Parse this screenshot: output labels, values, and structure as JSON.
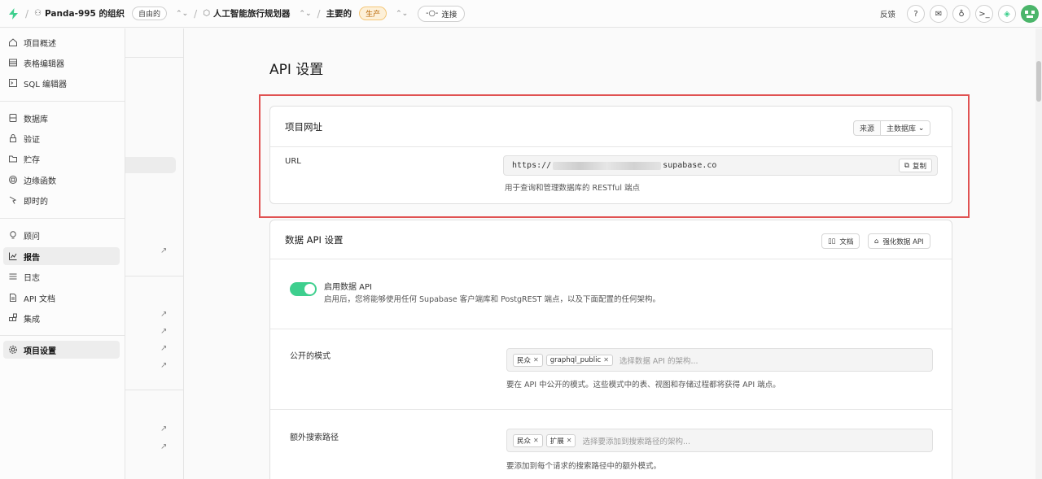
{
  "topbar": {
    "org_name": "Panda-995 的组织",
    "org_plan": "自由的",
    "project_name": "人工智能旅行规划器",
    "branch_name": "主要的",
    "branch_env": "生产",
    "connect_label": "连接",
    "feedback_label": "反馈",
    "brand_color": "#3ecf8e"
  },
  "nav": {
    "items": [
      {
        "label": "项目概述",
        "icon": "home-icon"
      },
      {
        "label": "表格编辑器",
        "icon": "table-icon"
      },
      {
        "label": "SQL 编辑器",
        "icon": "terminal-icon"
      },
      {
        "label": "数据库",
        "icon": "database-icon"
      },
      {
        "label": "验证",
        "icon": "lock-icon"
      },
      {
        "label": "贮存",
        "icon": "folder-icon"
      },
      {
        "label": "边缘函数",
        "icon": "function-icon"
      },
      {
        "label": "即时的",
        "icon": "cursor-icon"
      },
      {
        "label": "顾问",
        "icon": "lightbulb-icon"
      },
      {
        "label": "报告",
        "icon": "chart-icon"
      },
      {
        "label": "日志",
        "icon": "list-icon"
      },
      {
        "label": "API 文档",
        "icon": "document-icon"
      },
      {
        "label": "集成",
        "icon": "blocks-icon"
      },
      {
        "label": "项目设置",
        "icon": "gear-icon"
      }
    ]
  },
  "main": {
    "title": "API 设置",
    "project_url": {
      "title": "项目网址",
      "source_label": "来源",
      "source_value": "主数据库",
      "url_label": "URL",
      "url_prefix": "https://",
      "url_suffix": "supabase.co",
      "copy_label": "复制",
      "hint": "用于查询和管理数据库的 RESTful 端点"
    },
    "data_api": {
      "title": "数据 API 设置",
      "docs_label": "文档",
      "harden_label": "强化数据 API",
      "enable_label": "启用数据 API",
      "enable_desc": "启用后，您将能够使用任何 Supabase 客户端库和 PostgREST 端点，以及下面配置的任何架构。",
      "enabled": true,
      "exposed_label": "公开的模式",
      "exposed_tags": [
        "民众",
        "graphql_public"
      ],
      "exposed_placeholder": "选择数据 API 的架构...",
      "exposed_hint": "要在 API 中公开的模式。这些模式中的表、视图和存储过程都将获得 API 端点。",
      "search_label": "额外搜索路径",
      "search_tags": [
        "民众",
        "扩展"
      ],
      "search_placeholder": "选择要添加到搜索路径的架构...",
      "search_hint": "要添加到每个请求的搜索路径中的额外模式。"
    }
  }
}
